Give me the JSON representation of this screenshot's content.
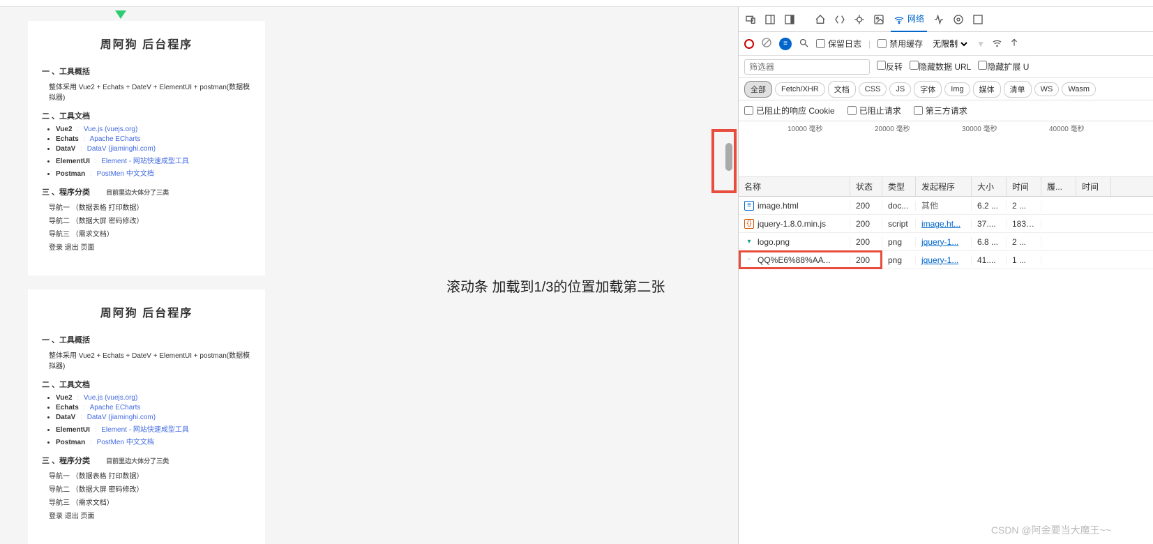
{
  "triangle": "▼",
  "annotation": "滚动条 加载到1/3的位置加载第二张",
  "watermark": "CSDN @阿金要当大魔王~~",
  "doc": {
    "title": "周阿狗 后台程序",
    "s1": "一 、工具概括",
    "s1_line": "整体采用 Vue2 + Echats + DateV + ElementUI + postman(数据模拟器)",
    "s2": "二 、工具文档",
    "tools": [
      {
        "name": "Vue2",
        "link": "Vue.js (vuejs.org)"
      },
      {
        "name": "Echats",
        "link": "Apache ECharts"
      },
      {
        "name": "DataV",
        "link": "DataV (jiaminghi.com)"
      },
      {
        "name": "ElementUI",
        "link": "Element - 网站快速成型工具"
      },
      {
        "name": "Postman",
        "link": "PostMen 中文文档"
      }
    ],
    "s3": "三 、程序分类",
    "s3_note": "目前里边大体分了三类",
    "nav1": "导航一 （数据表格 打印数据）",
    "nav2": "导航二 （数据大屏 密码修改）",
    "nav3": "导航三 （需求文档）",
    "nav4": "登录 退出 页面"
  },
  "devtools": {
    "net_label": "网络",
    "preserve": "保留日志",
    "disable_cache": "禁用缓存",
    "throttle": "无限制",
    "filter_ph": "筛选器",
    "invert": "反转",
    "hide_data": "隐藏数据 URL",
    "hide_ext": "隐藏扩展 U",
    "types": [
      "全部",
      "Fetch/XHR",
      "文档",
      "CSS",
      "JS",
      "字体",
      "Img",
      "媒体",
      "清单",
      "WS",
      "Wasm"
    ],
    "chk1": "已阻止的响应 Cookie",
    "chk2": "已阻止请求",
    "chk3": "第三方请求",
    "ticks": [
      "10000 毫秒",
      "20000 毫秒",
      "30000 毫秒",
      "40000 毫秒"
    ],
    "headers": {
      "name": "名称",
      "status": "状态",
      "type": "类型",
      "init": "发起程序",
      "size": "大小",
      "time": "时间",
      "wf": "履...",
      "tl": "时间"
    },
    "rows": [
      {
        "icon": "doc",
        "name": "image.html",
        "status": "200",
        "type": "doc...",
        "init": "其他",
        "init_link": false,
        "size": "6.2 ...",
        "time": "2 ..."
      },
      {
        "icon": "js",
        "name": "jquery-1.8.0.min.js",
        "status": "200",
        "type": "script",
        "init": "image.ht...",
        "init_link": true,
        "size": "37....",
        "time": "183 ..."
      },
      {
        "icon": "img",
        "name": "logo.png",
        "status": "200",
        "type": "png",
        "init": "jquery-1...",
        "init_link": true,
        "size": "6.8 ...",
        "time": "2 ..."
      },
      {
        "icon": "img",
        "name": "QQ%E6%88%AA...",
        "status": "200",
        "type": "png",
        "init": "jquery-1...",
        "init_link": true,
        "size": "41....",
        "time": "1 ..."
      }
    ]
  }
}
